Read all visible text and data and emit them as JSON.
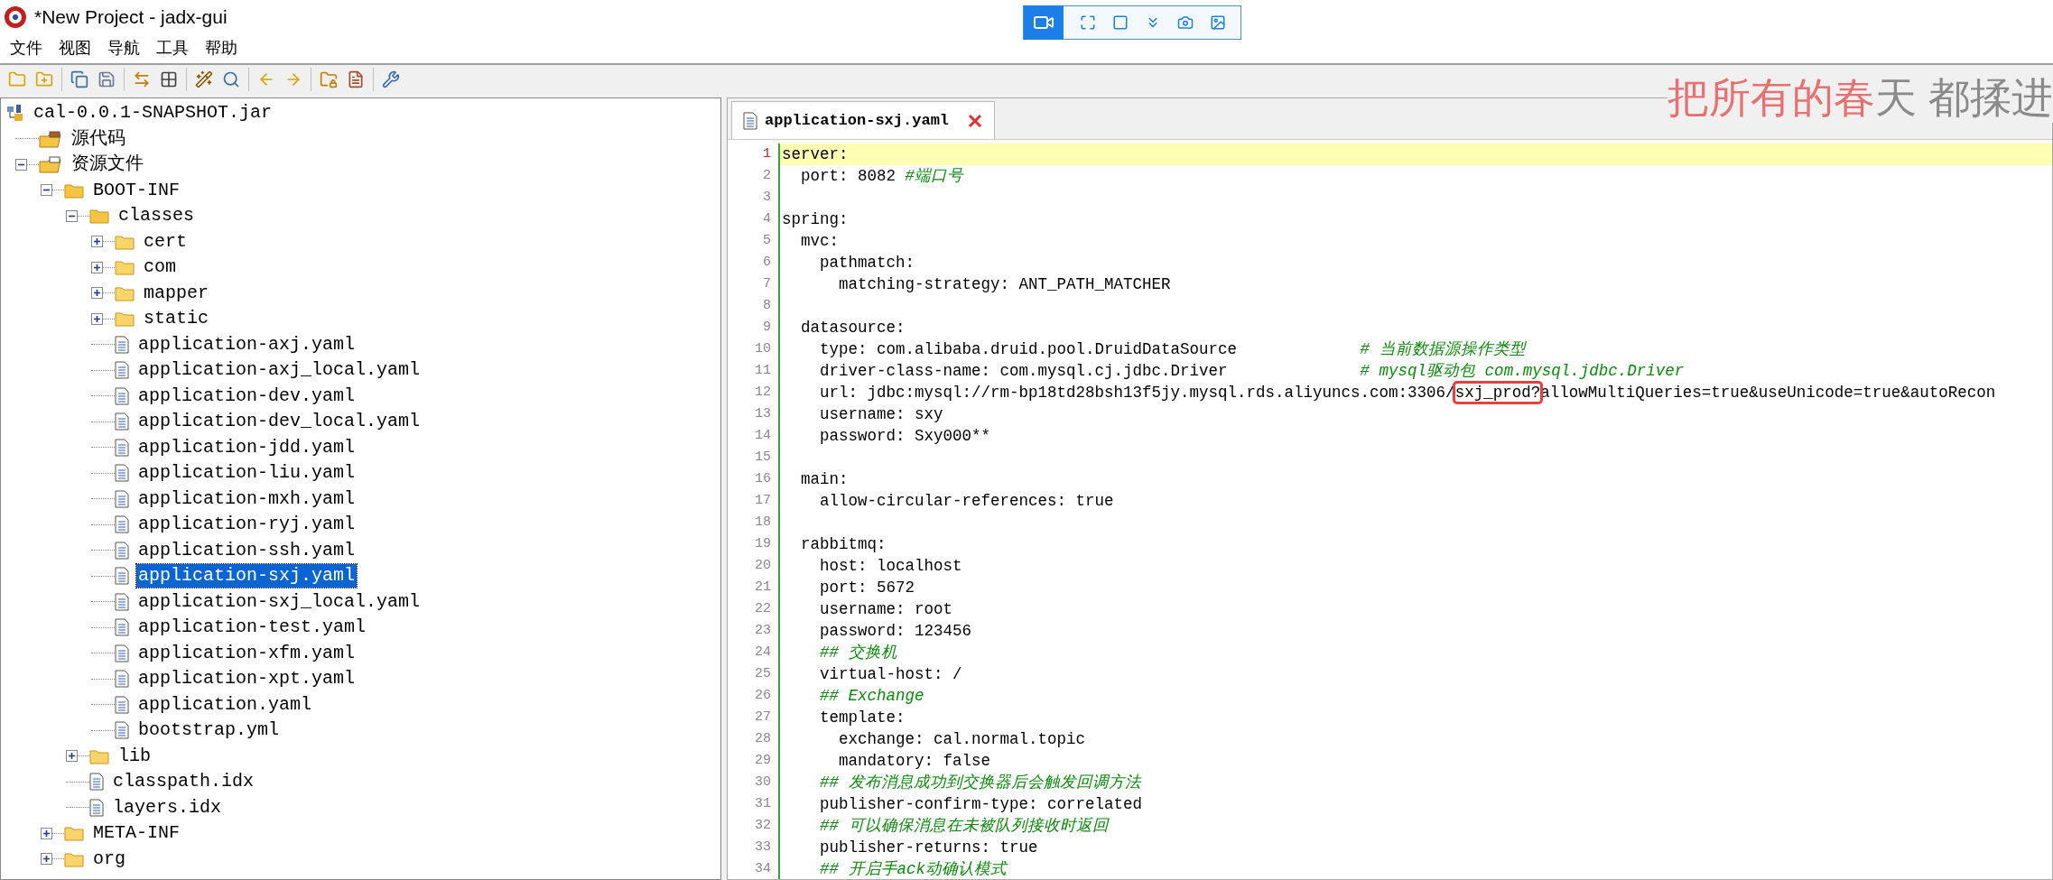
{
  "window": {
    "title": "*New Project - jadx-gui"
  },
  "menu": [
    "文件",
    "视图",
    "导航",
    "工具",
    "帮助"
  ],
  "tree": [
    {
      "kind": "jar",
      "label": "cal-0.0.1-SNAPSHOT.jar",
      "selected": false,
      "children": [
        {
          "kind": "sources",
          "label": "源代码",
          "selected": false
        },
        {
          "kind": "resources",
          "label": "资源文件",
          "selected": false,
          "expanded": true,
          "children": [
            {
              "kind": "folder",
              "label": "BOOT-INF",
              "selected": false,
              "expanded": true,
              "children": [
                {
                  "kind": "folder",
                  "label": "classes",
                  "selected": false,
                  "expanded": true,
                  "children": [
                    {
                      "kind": "folder",
                      "label": "cert",
                      "selected": false,
                      "expanded": false
                    },
                    {
                      "kind": "folder",
                      "label": "com",
                      "selected": false,
                      "expanded": false
                    },
                    {
                      "kind": "folder",
                      "label": "mapper",
                      "selected": false,
                      "expanded": false
                    },
                    {
                      "kind": "folder",
                      "label": "static",
                      "selected": false,
                      "expanded": false
                    },
                    {
                      "kind": "file",
                      "label": "application-axj.yaml",
                      "selected": false
                    },
                    {
                      "kind": "file",
                      "label": "application-axj_local.yaml",
                      "selected": false
                    },
                    {
                      "kind": "file",
                      "label": "application-dev.yaml",
                      "selected": false
                    },
                    {
                      "kind": "file",
                      "label": "application-dev_local.yaml",
                      "selected": false
                    },
                    {
                      "kind": "file",
                      "label": "application-jdd.yaml",
                      "selected": false
                    },
                    {
                      "kind": "file",
                      "label": "application-liu.yaml",
                      "selected": false
                    },
                    {
                      "kind": "file",
                      "label": "application-mxh.yaml",
                      "selected": false
                    },
                    {
                      "kind": "file",
                      "label": "application-ryj.yaml",
                      "selected": false
                    },
                    {
                      "kind": "file",
                      "label": "application-ssh.yaml",
                      "selected": false
                    },
                    {
                      "kind": "file",
                      "label": "application-sxj.yaml",
                      "selected": true
                    },
                    {
                      "kind": "file",
                      "label": "application-sxj_local.yaml",
                      "selected": false
                    },
                    {
                      "kind": "file",
                      "label": "application-test.yaml",
                      "selected": false
                    },
                    {
                      "kind": "file",
                      "label": "application-xfm.yaml",
                      "selected": false
                    },
                    {
                      "kind": "file",
                      "label": "application-xpt.yaml",
                      "selected": false
                    },
                    {
                      "kind": "file",
                      "label": "application.yaml",
                      "selected": false
                    },
                    {
                      "kind": "file",
                      "label": "bootstrap.yml",
                      "selected": false
                    }
                  ]
                },
                {
                  "kind": "folder",
                  "label": "lib",
                  "selected": false,
                  "expanded": false
                },
                {
                  "kind": "file",
                  "label": "classpath.idx",
                  "selected": false
                },
                {
                  "kind": "file",
                  "label": "layers.idx",
                  "selected": false
                }
              ]
            },
            {
              "kind": "folder",
              "label": "META-INF",
              "selected": false,
              "expanded": false
            },
            {
              "kind": "folder",
              "label": "org",
              "selected": false,
              "expanded": false
            }
          ]
        }
      ]
    }
  ],
  "tabs": [
    {
      "label": "application-sxj.yaml",
      "selected": true
    }
  ],
  "desktop_lyrics": {
    "sung": "把所有的春",
    "unsung": "天 都揉进"
  },
  "code": [
    {
      "number": "1",
      "selected": true,
      "segments": [
        {
          "kind": "text",
          "text": "server:"
        }
      ]
    },
    {
      "number": "2",
      "selected": false,
      "segments": [
        {
          "kind": "text",
          "text": "  port: 8082 "
        },
        {
          "kind": "comment",
          "text": "#端口号"
        }
      ]
    },
    {
      "number": "3",
      "selected": false
    },
    {
      "number": "4",
      "selected": false,
      "segments": [
        {
          "kind": "text",
          "text": "spring:"
        }
      ]
    },
    {
      "number": "5",
      "selected": false,
      "segments": [
        {
          "kind": "text",
          "text": "  mvc:"
        }
      ]
    },
    {
      "number": "6",
      "selected": false,
      "segments": [
        {
          "kind": "text",
          "text": "    pathmatch:"
        }
      ]
    },
    {
      "number": "7",
      "selected": false,
      "segments": [
        {
          "kind": "text",
          "text": "      matching-strategy: ANT_PATH_MATCHER"
        }
      ]
    },
    {
      "number": "8",
      "selected": false
    },
    {
      "number": "9",
      "selected": false,
      "segments": [
        {
          "kind": "text",
          "text": "  datasource:"
        }
      ]
    },
    {
      "number": "10",
      "selected": false,
      "segments": [
        {
          "kind": "text",
          "text": "    type: com.alibaba.druid.pool.DruidDataSource             "
        },
        {
          "kind": "comment",
          "text": "# 当前数据源操作类型"
        }
      ]
    },
    {
      "number": "11",
      "selected": false,
      "segments": [
        {
          "kind": "text",
          "text": "    driver-class-name: com.mysql.cj.jdbc.Driver              "
        },
        {
          "kind": "comment",
          "text": "# mysql驱动包 com.mysql.jdbc.Driver"
        }
      ]
    },
    {
      "number": "12",
      "selected": false,
      "segments": [
        {
          "kind": "text",
          "text": "    url: jdbc:mysql://rm-bp18td28bsh13f5jy.mysql.rds.aliyuncs.com:3306/"
        },
        {
          "kind": "marked",
          "text": "sxj_prod?"
        },
        {
          "kind": "text",
          "text": "allowMultiQueries=true&useUnicode=true&autoRecon"
        }
      ]
    },
    {
      "number": "13",
      "selected": false,
      "segments": [
        {
          "kind": "text",
          "text": "    username: sxy"
        }
      ]
    },
    {
      "number": "14",
      "selected": false,
      "segments": [
        {
          "kind": "text",
          "text": "    password: Sxy000**"
        }
      ]
    },
    {
      "number": "15",
      "selected": false
    },
    {
      "number": "16",
      "selected": false,
      "segments": [
        {
          "kind": "text",
          "text": "  main:"
        }
      ]
    },
    {
      "number": "17",
      "selected": false,
      "segments": [
        {
          "kind": "text",
          "text": "    allow-circular-references: true"
        }
      ]
    },
    {
      "number": "18",
      "selected": false
    },
    {
      "number": "19",
      "selected": false,
      "segments": [
        {
          "kind": "text",
          "text": "  rabbitmq:"
        }
      ]
    },
    {
      "number": "20",
      "selected": false,
      "segments": [
        {
          "kind": "text",
          "text": "    host: localhost"
        }
      ]
    },
    {
      "number": "21",
      "selected": false,
      "segments": [
        {
          "kind": "text",
          "text": "    port: 5672"
        }
      ]
    },
    {
      "number": "22",
      "selected": false,
      "segments": [
        {
          "kind": "text",
          "text": "    username: root"
        }
      ]
    },
    {
      "number": "23",
      "selected": false,
      "segments": [
        {
          "kind": "text",
          "text": "    password: 123456"
        }
      ]
    },
    {
      "number": "24",
      "selected": false,
      "segments": [
        {
          "kind": "comment",
          "text": "    ## 交换机"
        }
      ]
    },
    {
      "number": "25",
      "selected": false,
      "segments": [
        {
          "kind": "text",
          "text": "    virtual-host: /"
        }
      ]
    },
    {
      "number": "26",
      "selected": false,
      "segments": [
        {
          "kind": "comment",
          "text": "    ## Exchange"
        }
      ]
    },
    {
      "number": "27",
      "selected": false,
      "segments": [
        {
          "kind": "text",
          "text": "    template:"
        }
      ]
    },
    {
      "number": "28",
      "selected": false,
      "segments": [
        {
          "kind": "text",
          "text": "      exchange: cal.normal.topic"
        }
      ]
    },
    {
      "number": "29",
      "selected": false,
      "segments": [
        {
          "kind": "text",
          "text": "      mandatory: false"
        }
      ]
    },
    {
      "number": "30",
      "selected": false,
      "segments": [
        {
          "kind": "comment",
          "text": "    ## 发布消息成功到交换器后会触发回调方法"
        }
      ]
    },
    {
      "number": "31",
      "selected": false,
      "segments": [
        {
          "kind": "text",
          "text": "    publisher-confirm-type: correlated"
        }
      ]
    },
    {
      "number": "32",
      "selected": false,
      "segments": [
        {
          "kind": "comment",
          "text": "    ## 可以确保消息在未被队列接收时返回"
        }
      ]
    },
    {
      "number": "33",
      "selected": false,
      "segments": [
        {
          "kind": "text",
          "text": "    publisher-returns: true"
        }
      ]
    },
    {
      "number": "34",
      "selected": false,
      "segments": [
        {
          "kind": "comment",
          "text": "    ## 开启手ack动确认模式"
        }
      ]
    }
  ]
}
